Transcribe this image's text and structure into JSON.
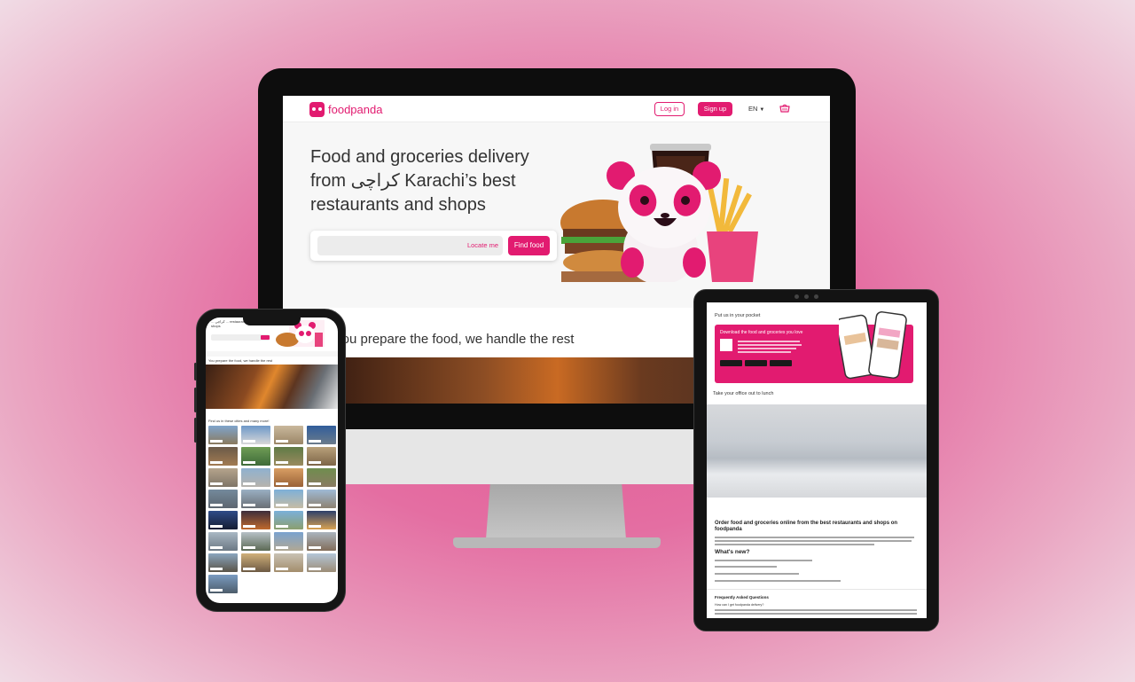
{
  "desktop": {
    "brand": "foodpanda",
    "nav": {
      "login": "Log in",
      "signup": "Sign up",
      "language": "EN"
    },
    "hero": {
      "title": "Food and groceries delivery from کراچی Karachi’s best restaurants and shops",
      "locate": "Locate me",
      "find": "Find food"
    },
    "section_title": "You prepare the food, we handle the rest"
  },
  "phone": {
    "hero_text": "... کراچی ... restaurants and shops",
    "section1": "You prepare the food, we handle the rest",
    "section2": "Find us in these cities and many more!"
  },
  "tablet": {
    "pocket_title": "Put us in your pocket",
    "pocket_banner": "Download the food and groceries you love",
    "office_title": "Take your office out to lunch",
    "order_title": "Order food and groceries online from the best restaurants and shops on foodpanda",
    "whats_new": "What's new?",
    "faq_title": "Frequently Asked Questions",
    "faq_q1": "How can I get foodpanda delivery?"
  },
  "colors": {
    "brand": "#e21b70",
    "background": "#e46ea2"
  },
  "icons": {
    "logo": "panda-face-icon",
    "cart": "basket-icon",
    "caret": "caret-down-icon"
  }
}
